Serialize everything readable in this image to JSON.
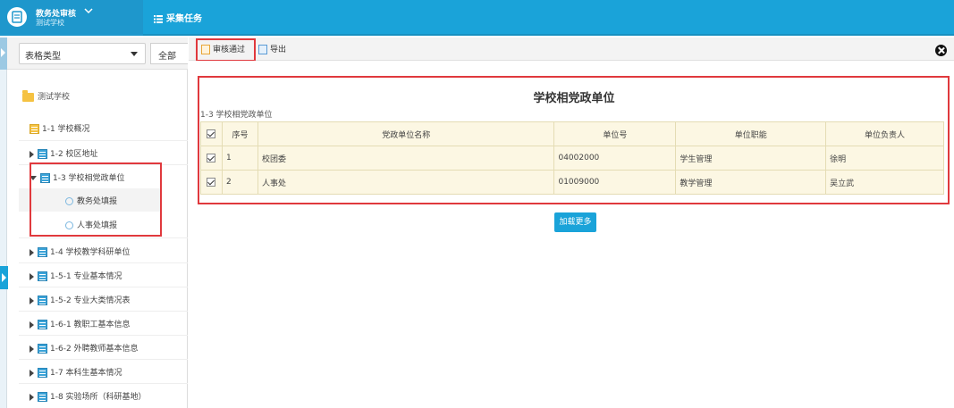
{
  "header": {
    "app_title": "教务处审核",
    "app_subtitle": "测试学校",
    "tab_collect": "采集任务"
  },
  "filter": {
    "table_type": "表格类型",
    "scope": "全部"
  },
  "tree": {
    "root": "测试学校",
    "items": [
      {
        "label": "1-1 学校概况"
      },
      {
        "label": "1-2 校区地址"
      },
      {
        "label": "1-3 学校相党政单位"
      },
      {
        "label": "1-4 学校教学科研单位"
      },
      {
        "label": "1-5-1 专业基本情况"
      },
      {
        "label": "1-5-2 专业大类情况表"
      },
      {
        "label": "1-6-1 教职工基本信息"
      },
      {
        "label": "1-6-2 外聘教师基本信息"
      },
      {
        "label": "1-7 本科生基本情况"
      },
      {
        "label": "1-8 实验场所（科研基地）"
      }
    ],
    "subitems": [
      {
        "label": "教务处填报"
      },
      {
        "label": "人事处填报"
      }
    ]
  },
  "toolbar": {
    "approve": "审核通过",
    "export": "导出"
  },
  "main": {
    "title": "学校相党政单位",
    "caption": "1-3 学校相党政单位",
    "columns": [
      "序号",
      "党政单位名称",
      "单位号",
      "单位职能",
      "单位负责人"
    ],
    "rows": [
      {
        "no": "1",
        "name": "校团委",
        "code": "04002000",
        "function": "学生管理",
        "leader": "徐明"
      },
      {
        "no": "2",
        "name": "人事处",
        "code": "01009000",
        "function": "教学管理",
        "leader": "吴立武"
      }
    ],
    "load_more": "加载更多"
  },
  "colors": {
    "header_blue": "#1aa3d9",
    "highlight_red": "#e0393d",
    "table_bg": "#fcf7e3"
  },
  "icons": [
    "app-logo-icon",
    "chevron-down-icon",
    "list-icon",
    "folder-icon",
    "table-icon",
    "user-icon",
    "approve-icon",
    "export-icon",
    "close-icon"
  ]
}
